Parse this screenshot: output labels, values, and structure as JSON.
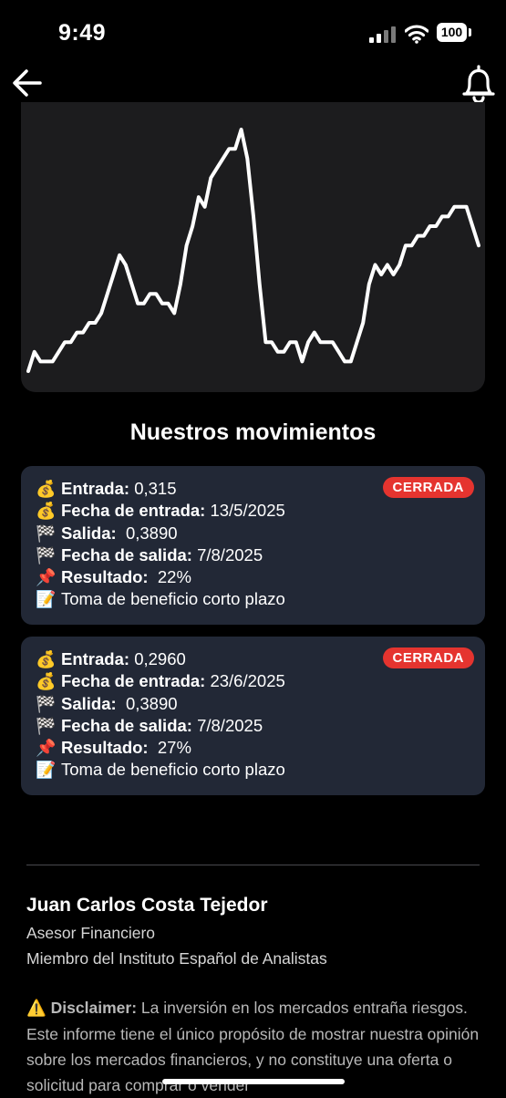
{
  "status_bar": {
    "time": "9:49",
    "battery": "100"
  },
  "header": {
    "back_icon": "arrow-left-icon",
    "bell_icon": "bell-icon"
  },
  "chart_data": {
    "type": "line",
    "color": "#ffffff",
    "background": "#1c1c1e",
    "title": "",
    "xlabel": "",
    "ylabel": "",
    "x": [],
    "y": [
      0.27,
      0.29,
      0.28,
      0.28,
      0.28,
      0.29,
      0.3,
      0.3,
      0.31,
      0.31,
      0.32,
      0.32,
      0.33,
      0.35,
      0.37,
      0.39,
      0.38,
      0.36,
      0.34,
      0.34,
      0.35,
      0.35,
      0.34,
      0.34,
      0.33,
      0.36,
      0.4,
      0.42,
      0.45,
      0.44,
      0.47,
      0.48,
      0.49,
      0.5,
      0.5,
      0.52,
      0.49,
      0.43,
      0.36,
      0.3,
      0.3,
      0.29,
      0.29,
      0.3,
      0.3,
      0.28,
      0.3,
      0.31,
      0.3,
      0.3,
      0.3,
      0.29,
      0.28,
      0.28,
      0.3,
      0.32,
      0.36,
      0.38,
      0.37,
      0.38,
      0.37,
      0.38,
      0.4,
      0.4,
      0.41,
      0.41,
      0.42,
      0.42,
      0.43,
      0.43,
      0.44,
      0.44,
      0.44,
      0.42,
      0.4
    ]
  },
  "movements_title": "Nuestros movimientos",
  "trades": [
    {
      "status": "CERRADA",
      "entry_label": "Entrada:",
      "entry_value": "0,315",
      "entry_date_label": "Fecha de entrada:",
      "entry_date_value": "13/5/2025",
      "exit_label": "Salida:",
      "exit_value": "0,3890",
      "exit_date_label": "Fecha de salida:",
      "exit_date_value": "7/8/2025",
      "result_label": "Resultado:",
      "result_value": "22%",
      "note": "Toma de beneficio corto plazo"
    },
    {
      "status": "CERRADA",
      "entry_label": "Entrada:",
      "entry_value": "0,2960",
      "entry_date_label": "Fecha de entrada:",
      "entry_date_value": "23/6/2025",
      "exit_label": "Salida:",
      "exit_value": "0,3890",
      "exit_date_label": "Fecha de salida:",
      "exit_date_value": "7/8/2025",
      "result_label": "Resultado:",
      "result_value": "27%",
      "note": "Toma de beneficio corto plazo"
    }
  ],
  "author": {
    "name": "Juan Carlos Costa Tejedor",
    "role": "Asesor Financiero",
    "org": "Miembro del Instituto Español de Analistas"
  },
  "disclaimer": {
    "label": "Disclaimer:",
    "text": "La inversión en los mercados entraña riesgos. Este informe tiene el único propósito de mostrar nuestra opinión sobre los mercados financieros, y no constituye una oferta o solicitud para comprar o vender"
  },
  "icons": {
    "money": "💰",
    "checkered": "🏁",
    "pin": "📌",
    "note": "📝",
    "warning": "⚠️"
  }
}
